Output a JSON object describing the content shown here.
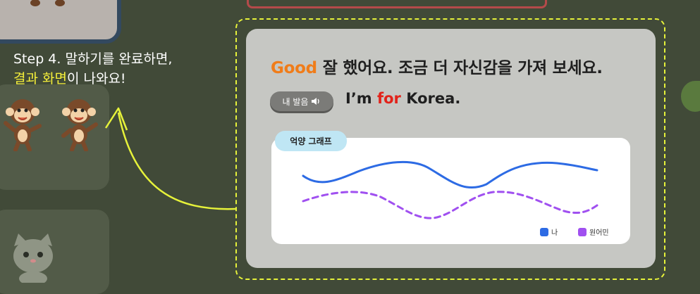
{
  "caption": {
    "line1": "Step 4. 말하기를 완료하면,",
    "line2_highlight": "결과 화면",
    "line2_rest": "이 나와요!"
  },
  "feedback": {
    "grade": "Good",
    "message": "잘 했어요. 조금 더 자신감을 가져 보세요."
  },
  "pronunciation_button": {
    "label": "내 발음",
    "icon": "speaker-icon"
  },
  "sentence": {
    "before": "I’m ",
    "highlight": "for",
    "after": " Korea."
  },
  "graph": {
    "label": "억양 그래프",
    "legend": [
      {
        "label": "나",
        "color": "#2d6be4"
      },
      {
        "label": "원어민",
        "color": "#a050f0"
      }
    ]
  },
  "colors": {
    "background": "#414a38",
    "accent_yellow": "#f5ef3a",
    "good_orange": "#f07c19",
    "error_red": "#e2231a",
    "my_line": "#2d6be4",
    "native_line": "#a050f0"
  }
}
